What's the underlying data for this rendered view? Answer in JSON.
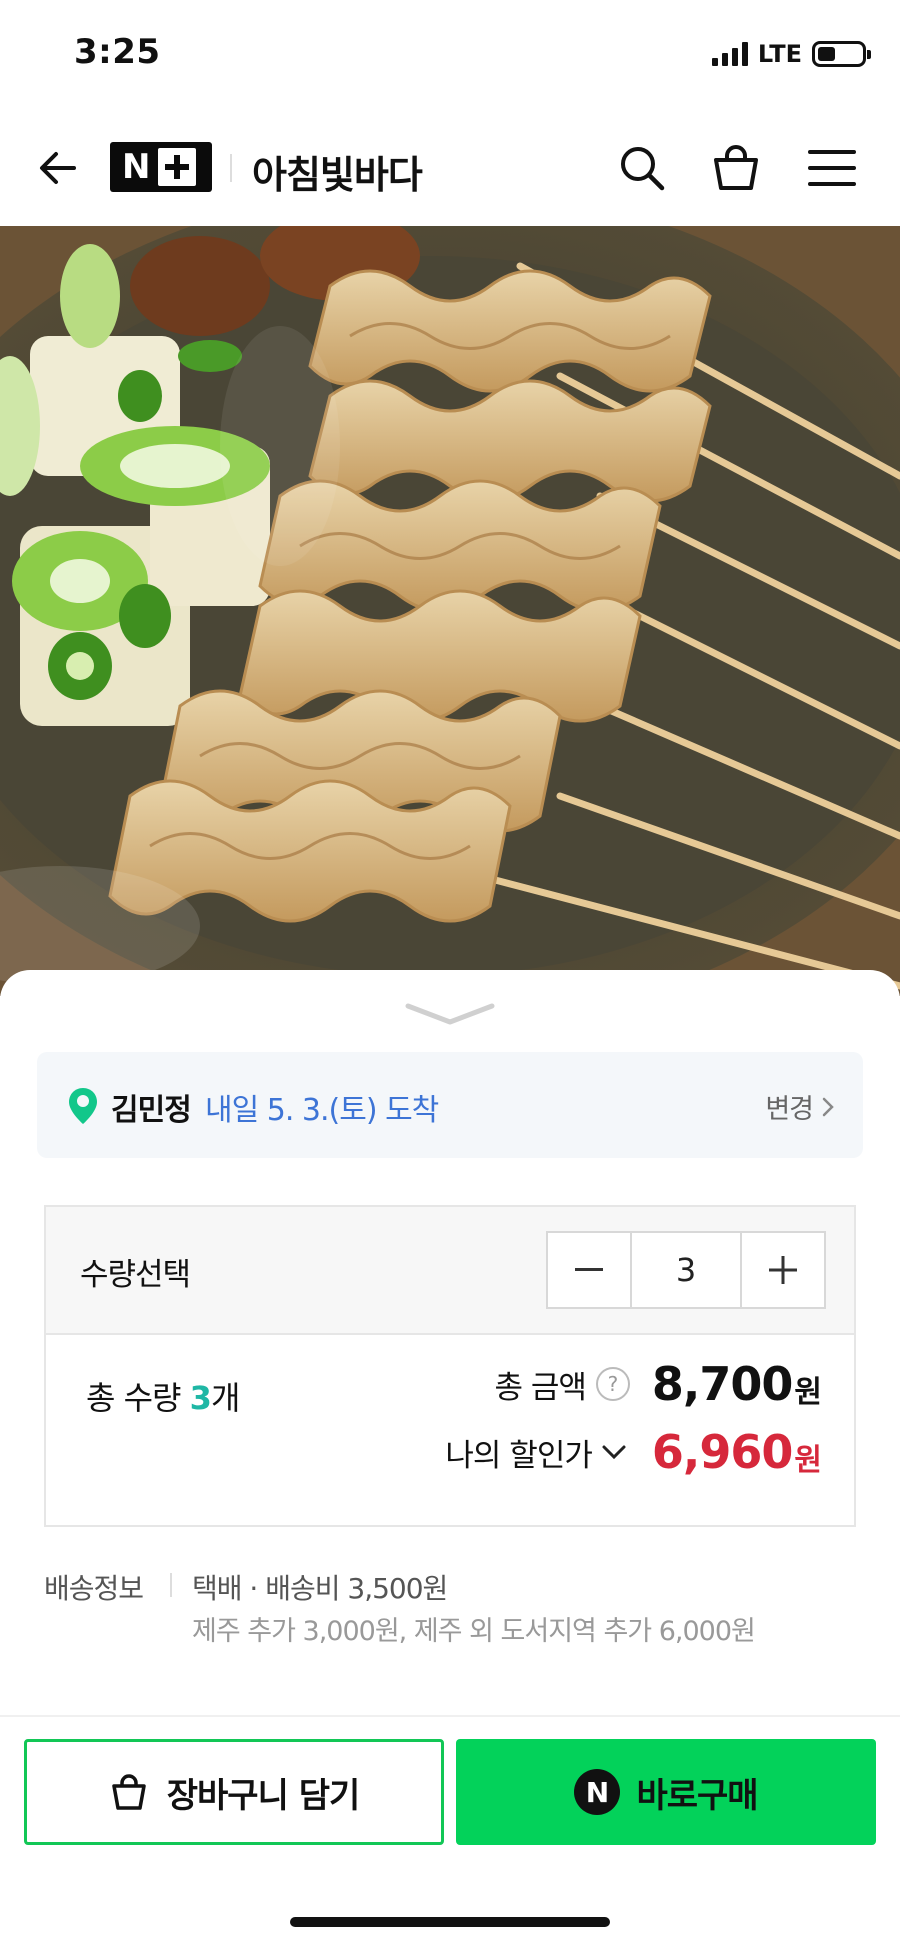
{
  "status_bar": {
    "time": "3:25",
    "network": "LTE",
    "battery_level": 0.4
  },
  "header": {
    "store_name": "아침빛바다",
    "logo_label": "N+",
    "icons": [
      "back-arrow-icon",
      "search-icon",
      "shopping-bag-icon",
      "menu-icon"
    ]
  },
  "product_image": {
    "subject": "fish cake skewers (eomuk) in broth"
  },
  "delivery": {
    "recipient": "김민정",
    "arrival": "내일 5. 3.(토) 도착",
    "change_label": "변경"
  },
  "quantity": {
    "label": "수량선택",
    "value": "3"
  },
  "summary": {
    "total_qty_prefix": "총 수량 ",
    "total_qty_num": "3",
    "total_qty_suffix": "개",
    "total_price_label": "총 금액",
    "help_label": "?",
    "total_price": "8,700",
    "currency": "원",
    "discount_label": "나의 할인가",
    "discount_price": "6,960"
  },
  "shipping": {
    "label": "배송정보",
    "main": "택배 · 배송비 3,500원",
    "extra": "제주 추가 3,000원, 제주 외 도서지역 추가 6,000원"
  },
  "actions": {
    "cart_label": "장바구니 담기",
    "buy_label": "바로구매",
    "npay_letter": "N"
  },
  "colors": {
    "accent_green": "#03d25a",
    "link_blue": "#3d74d6",
    "discount_red": "#d6283b",
    "qty_teal": "#1fb7a5"
  }
}
